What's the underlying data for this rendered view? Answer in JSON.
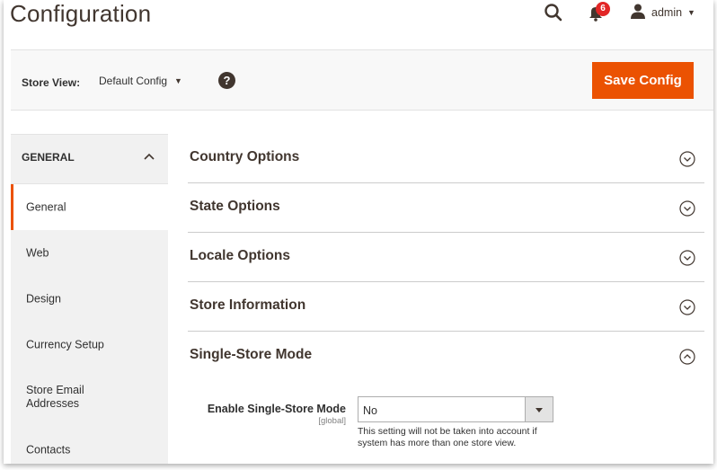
{
  "header": {
    "title": "Configuration",
    "notifications_count": "6",
    "user_name": "admin",
    "icons": [
      "search-icon",
      "bell-icon",
      "user-icon"
    ]
  },
  "store_bar": {
    "label": "Store View:",
    "selected": "Default Config",
    "help": "?",
    "save_label": "Save Config"
  },
  "sidebar": {
    "group_label": "GENERAL",
    "items": [
      {
        "label": "General",
        "active": true
      },
      {
        "label": "Web"
      },
      {
        "label": "Design"
      },
      {
        "label": "Currency Setup"
      },
      {
        "label": "Store Email Addresses"
      },
      {
        "label": "Contacts"
      }
    ]
  },
  "sections": [
    {
      "title": "Country Options"
    },
    {
      "title": "State Options"
    },
    {
      "title": "Locale Options"
    },
    {
      "title": "Store Information"
    },
    {
      "title": "Single-Store Mode",
      "expanded": true
    }
  ],
  "single_store": {
    "field_label": "Enable Single-Store Mode",
    "scope": "[global]",
    "value": "No",
    "note": "This setting will not be taken into account if system has more than one store view."
  },
  "colors": {
    "accent": "#eb5202",
    "badge": "#e22626",
    "text": "#41362f"
  }
}
